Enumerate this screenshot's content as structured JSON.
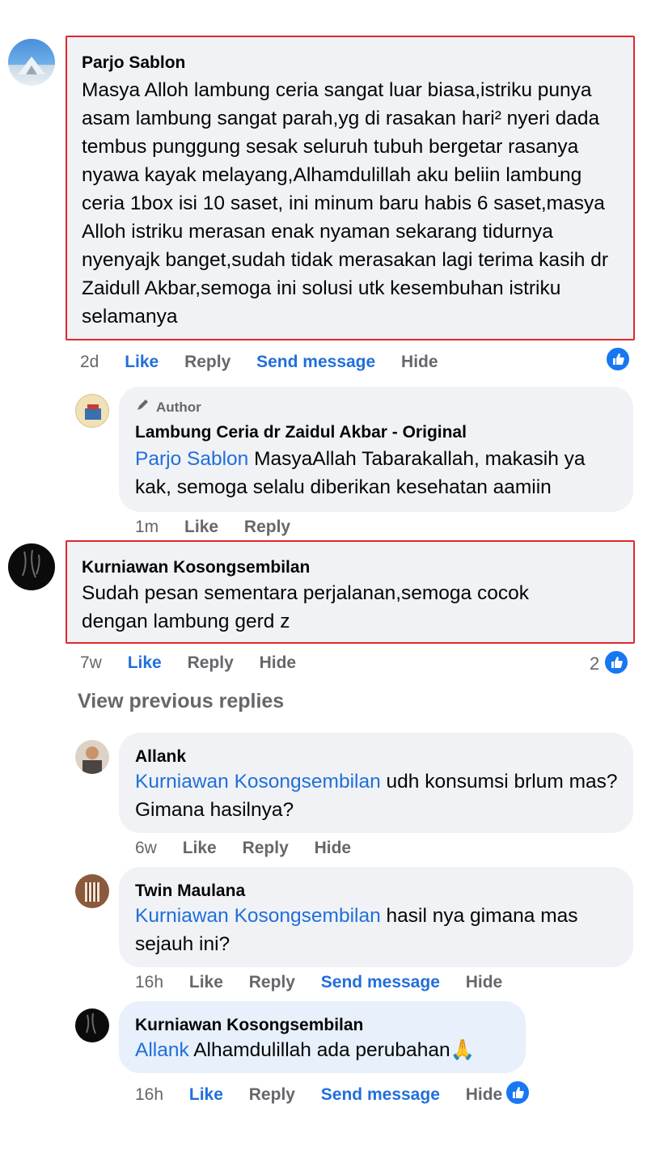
{
  "comments": {
    "c1": {
      "author": "Parjo Sablon",
      "text": "Masya Alloh lambung ceria sangat luar biasa,istriku punya asam lambung sangat parah,yg di rasakan hari² nyeri dada tembus punggung sesak seluruh tubuh bergetar rasanya nyawa kayak melayang,Alhamdulillah aku beliin lambung ceria 1box isi 10 saset, ini minum baru habis 6 saset,masya Alloh istriku merasan enak nyaman sekarang tidurnya nyenyajk banget,sudah tidak merasakan lagi terima kasih dr Zaidull Akbar,semoga ini solusi utk kesembuhan istriku selamanya",
      "time": "2d",
      "like": "Like",
      "reply": "Reply",
      "send": "Send message",
      "hide": "Hide"
    },
    "r1": {
      "badge": "Author",
      "author": "Lambung Ceria dr Zaidul Akbar - Original",
      "mention": "Parjo Sablon",
      "text": " MasyaAllah Tabarakallah, makasih ya kak, semoga selalu diberikan kesehatan aamiin",
      "time": "1m",
      "like": "Like",
      "reply": "Reply"
    },
    "c2": {
      "author": "Kurniawan Kosongsembilan",
      "text": "Sudah pesan sementara perjalanan,semoga cocok dengan lambung gerd z",
      "time": "7w",
      "like": "Like",
      "reply": "Reply",
      "hide": "Hide",
      "reaction_count": "2"
    },
    "view_previous": "View previous replies",
    "r2": {
      "author": "Allank",
      "mention": "Kurniawan Kosongsembilan",
      "text": " udh konsumsi brlum mas? Gimana hasilnya?",
      "time": "6w",
      "like": "Like",
      "reply": "Reply",
      "hide": "Hide"
    },
    "r3": {
      "author": "Twin Maulana",
      "mention": "Kurniawan Kosongsembilan",
      "text": " hasil nya gimana mas sejauh ini?",
      "time": "16h",
      "like": "Like",
      "reply": "Reply",
      "send": "Send message",
      "hide": "Hide"
    },
    "r4": {
      "author": "Kurniawan Kosongsembilan",
      "mention": "Allank",
      "text": " Alhamdulillah ada perubahan",
      "emoji": "🙏",
      "time": "16h",
      "like": "Like",
      "reply": "Reply",
      "send": "Send message",
      "hide": "Hide"
    }
  },
  "colors": {
    "highlight_border": "#e0282e",
    "bubble": "#f0f2f5",
    "link_blue": "#216fdb",
    "like_blue": "#1877f2"
  }
}
